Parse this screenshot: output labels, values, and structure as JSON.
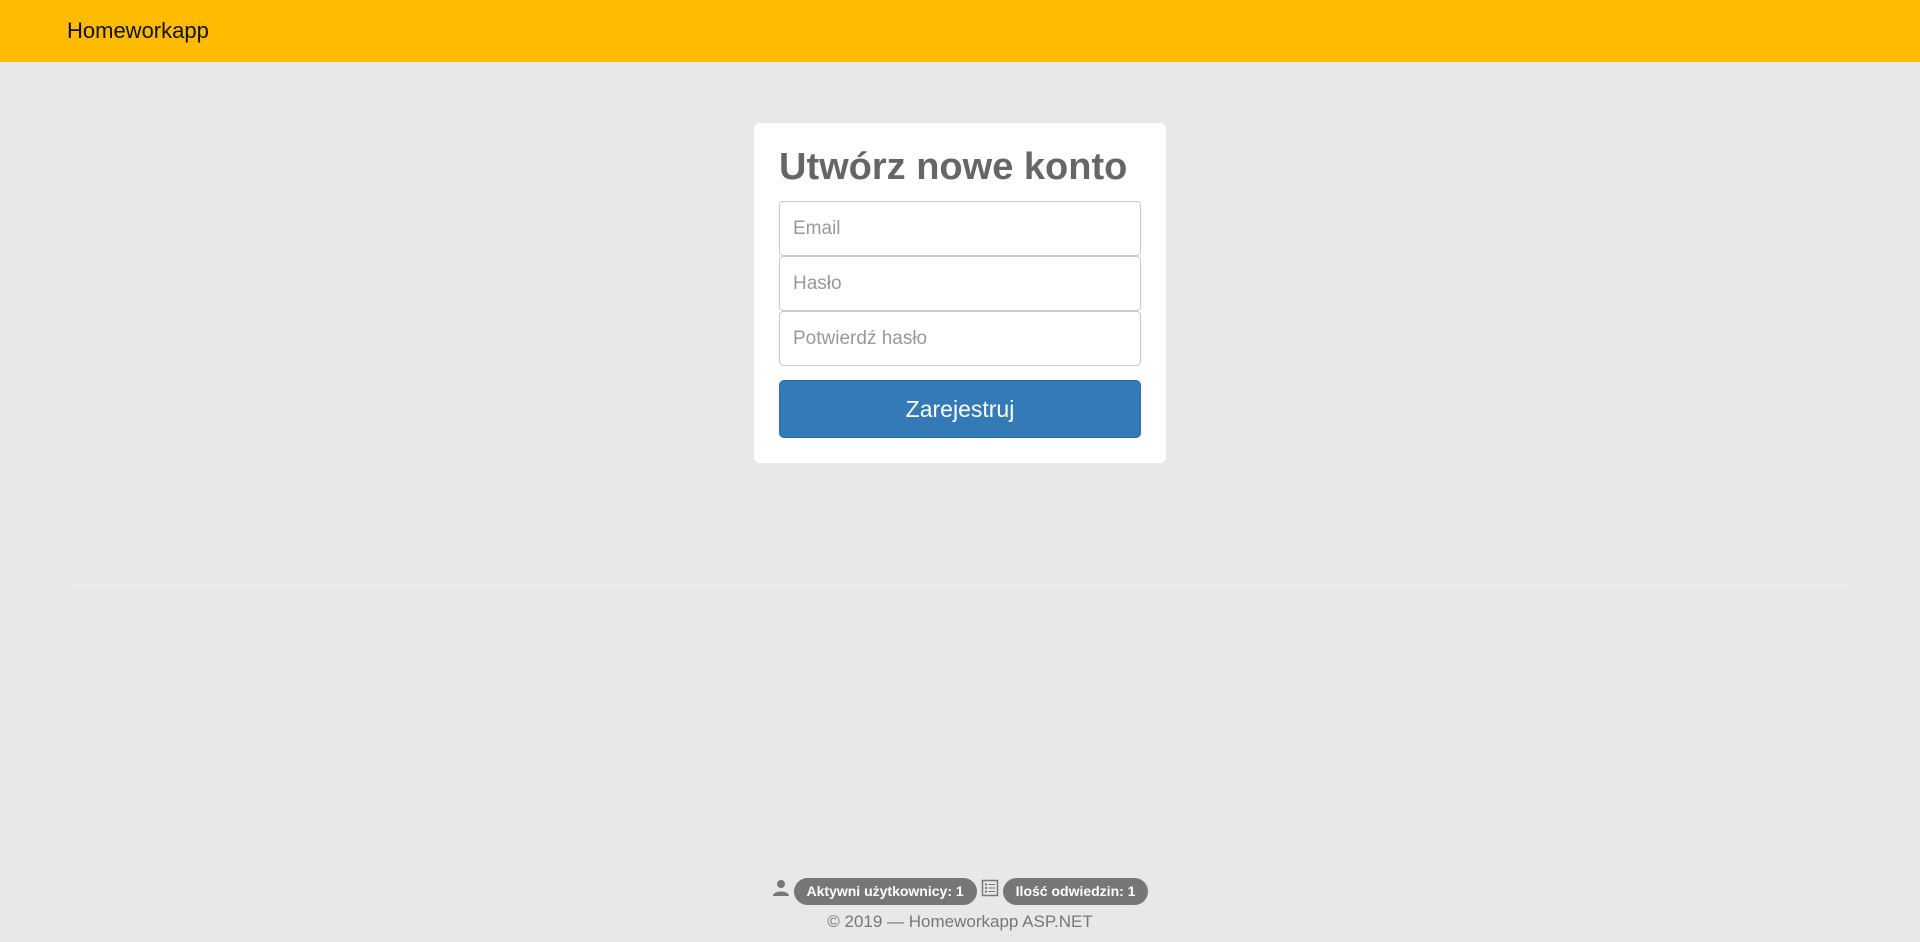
{
  "navbar": {
    "brand": "Homeworkapp",
    "background": "#ffbb00"
  },
  "register_form": {
    "title": "Utwórz nowe konto",
    "fields": {
      "email": {
        "placeholder": "Email",
        "value": ""
      },
      "password": {
        "placeholder": "Hasło",
        "value": ""
      },
      "confirm_password": {
        "placeholder": "Potwierdź hasło",
        "value": ""
      }
    },
    "submit_label": "Zarejestruj",
    "submit_color": "#337ab7"
  },
  "footer": {
    "stats": {
      "active_users": {
        "icon": "user-icon",
        "label": "Aktywni użytkownicy: 1"
      },
      "visits": {
        "icon": "list-icon",
        "label": "Ilość odwiedzin: 1"
      }
    },
    "copyright": "© 2019 — Homeworkapp ASP.NET"
  }
}
